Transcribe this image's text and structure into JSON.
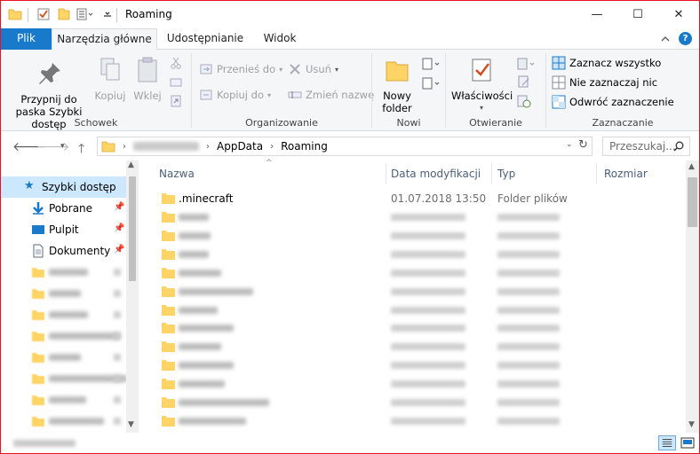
{
  "window": {
    "title": "Roaming",
    "controls": {
      "minimize": "—",
      "maximize": "☐",
      "close": "✕"
    }
  },
  "ribbon": {
    "tabs": [
      "Plik",
      "Narzędzia główne",
      "Udostępnianie",
      "Widok"
    ],
    "clipboard": {
      "pin": "Przypnij do paska Szybki dostęp",
      "copy": "Kopiuj",
      "paste": "Wklej",
      "label": "Schowek"
    },
    "organize": {
      "move_to": "Przenieś do",
      "copy_to": "Kopiuj do",
      "delete": "Usuń",
      "rename": "Zmień nazwę",
      "label": "Organizowanie"
    },
    "new": {
      "new_folder": "Nowy folder",
      "label": "Nowi"
    },
    "open": {
      "properties": "Właściwości",
      "label": "Otwieranie"
    },
    "select": {
      "select_all": "Zaznacz wszystko",
      "select_none": "Nie zaznaczaj nic",
      "invert": "Odwróć zaznaczenie",
      "label": "Zaznaczanie"
    }
  },
  "address": {
    "segments": [
      "AppData",
      "Roaming"
    ],
    "search_placeholder": "Przeszukaj..."
  },
  "nav": {
    "items": [
      {
        "label": "Szybki dostęp",
        "icon": "star-icon"
      },
      {
        "label": "Pobrane",
        "icon": "download-icon"
      },
      {
        "label": "Pulpit",
        "icon": "desktop-icon"
      },
      {
        "label": "Dokumenty",
        "icon": "document-icon"
      }
    ]
  },
  "files": {
    "columns": [
      "Nazwa",
      "Data modyfikacji",
      "Typ",
      "Rozmiar"
    ],
    "rows": [
      {
        "name": ".minecraft",
        "date": "01.07.2018 13:50",
        "type": "Folder plików"
      }
    ]
  },
  "colors": {
    "accent": "#1979ca",
    "selection": "#cce8ff",
    "folder": "#ffd467",
    "window_border": "#e81123"
  }
}
